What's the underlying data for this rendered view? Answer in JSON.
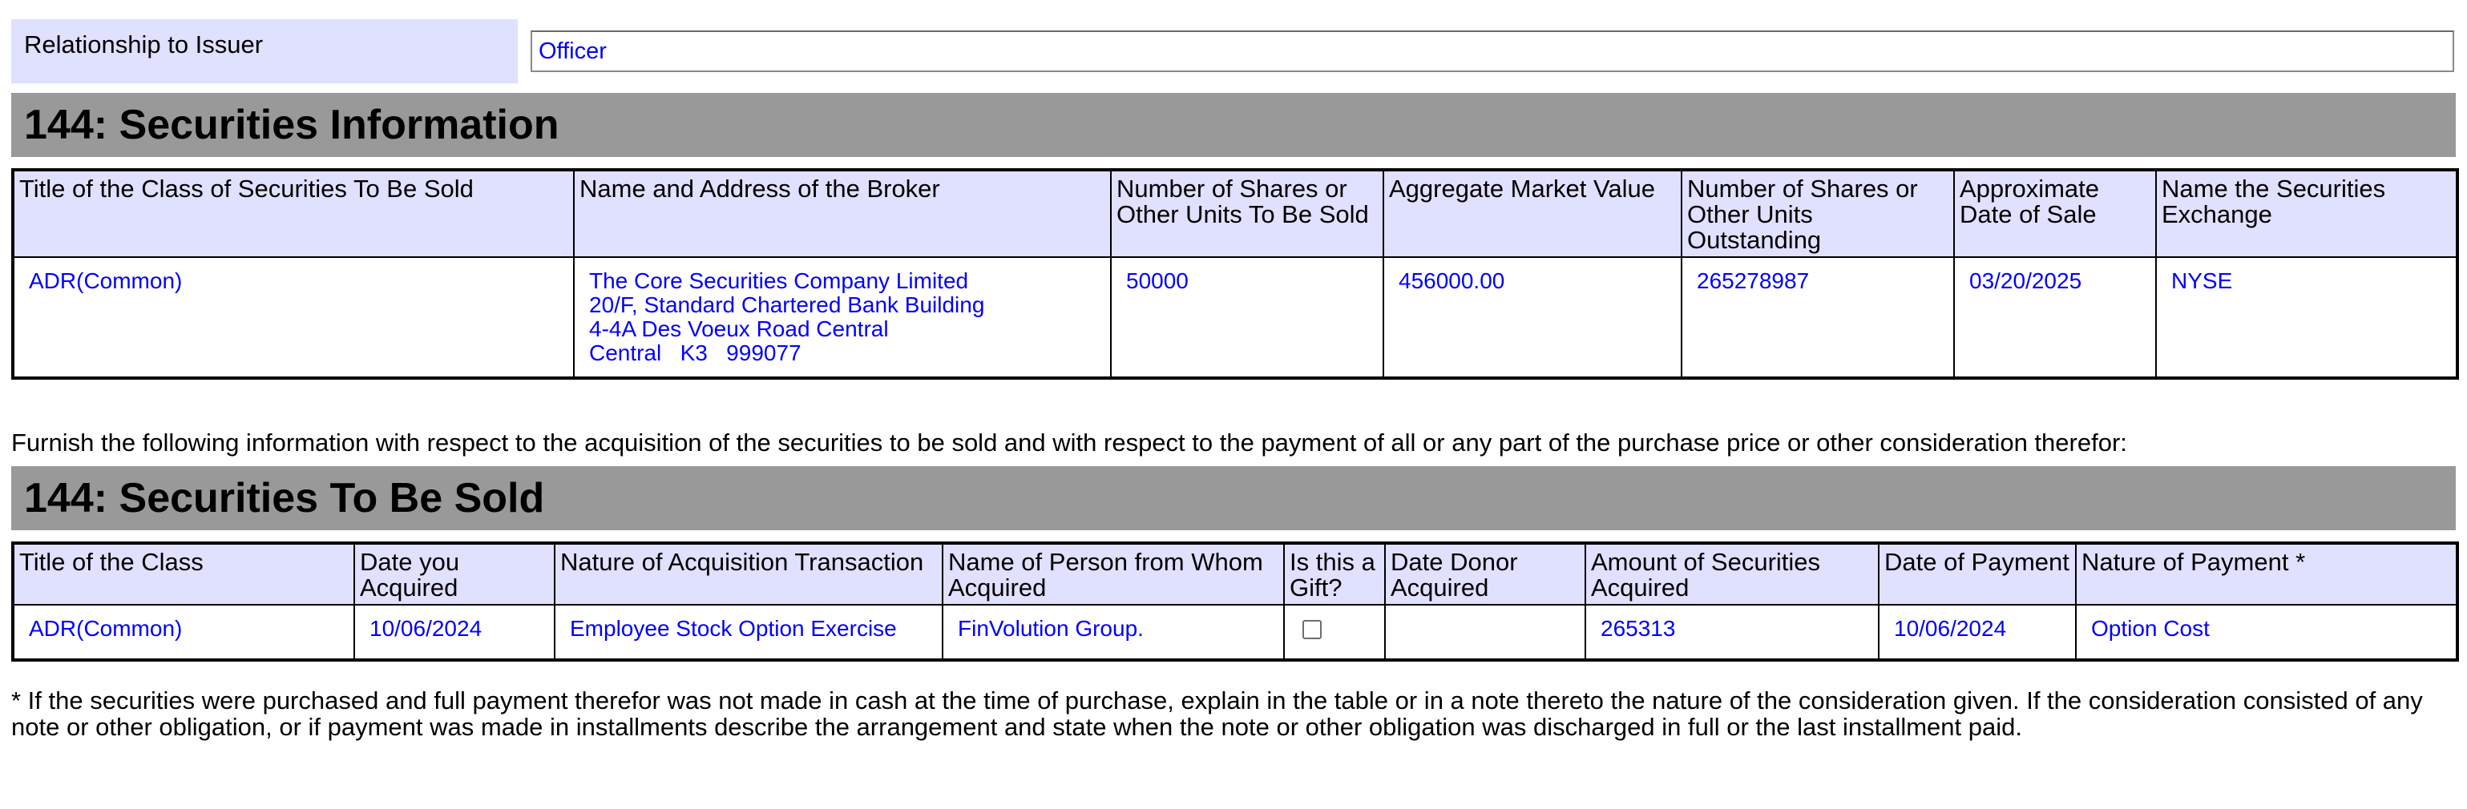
{
  "relationship": {
    "label": "Relationship to Issuer",
    "value": "Officer"
  },
  "securities_information": {
    "title": "144: Securities Information",
    "headers": [
      "Title of the Class of Securities To Be Sold",
      "Name and Address of the Broker",
      "Number of Shares or Other Units To Be Sold",
      "Aggregate Market Value",
      "Number of Shares or Other Units Outstanding",
      "Approximate Date of Sale",
      "Name the Securities Exchange"
    ],
    "row": {
      "class_title": "ADR(Common)",
      "broker_name": "The Core Securities Company Limited",
      "broker_address_1": "20/F, Standard Chartered Bank Building",
      "broker_address_2": "4-4A Des Voeux Road Central",
      "broker_address_3": "Central   K3   999077",
      "shares_to_be_sold": "50000",
      "aggregate_market_value": "456000.00",
      "shares_outstanding": "265278987",
      "date_of_sale": "03/20/2025",
      "exchange": "NYSE"
    }
  },
  "furnish_note": "Furnish the following information with respect to the acquisition of the securities to be sold and with respect to the payment of all or any part of the purchase price or other consideration therefor:",
  "securities_to_be_sold": {
    "title": "144: Securities To Be Sold",
    "headers": [
      "Title of the Class",
      "Date you Acquired",
      "Nature of Acquisition Transaction",
      "Name of Person from Whom Acquired",
      "Is this a Gift?",
      "Date Donor Acquired",
      "Amount of Securities Acquired",
      "Date of Payment",
      "Nature of Payment *"
    ],
    "row": {
      "class_title": "ADR(Common)",
      "date_acquired": "10/06/2024",
      "nature_of_acquisition": "Employee Stock Option Exercise",
      "acquired_from": "FinVolution Group.",
      "is_gift": false,
      "date_donor_acquired": "",
      "amount_acquired": "265313",
      "date_of_payment": "10/06/2024",
      "nature_of_payment": "Option Cost"
    }
  },
  "footnote": "* If the securities were purchased and full payment therefor was not made in cash at the time of purchase, explain in the table or in a note thereto the nature of the consideration given. If the consideration consisted of any note or other obligation, or if payment was made in installments describe the arrangement and state when the note or other obligation was discharged in full or the last installment paid."
}
